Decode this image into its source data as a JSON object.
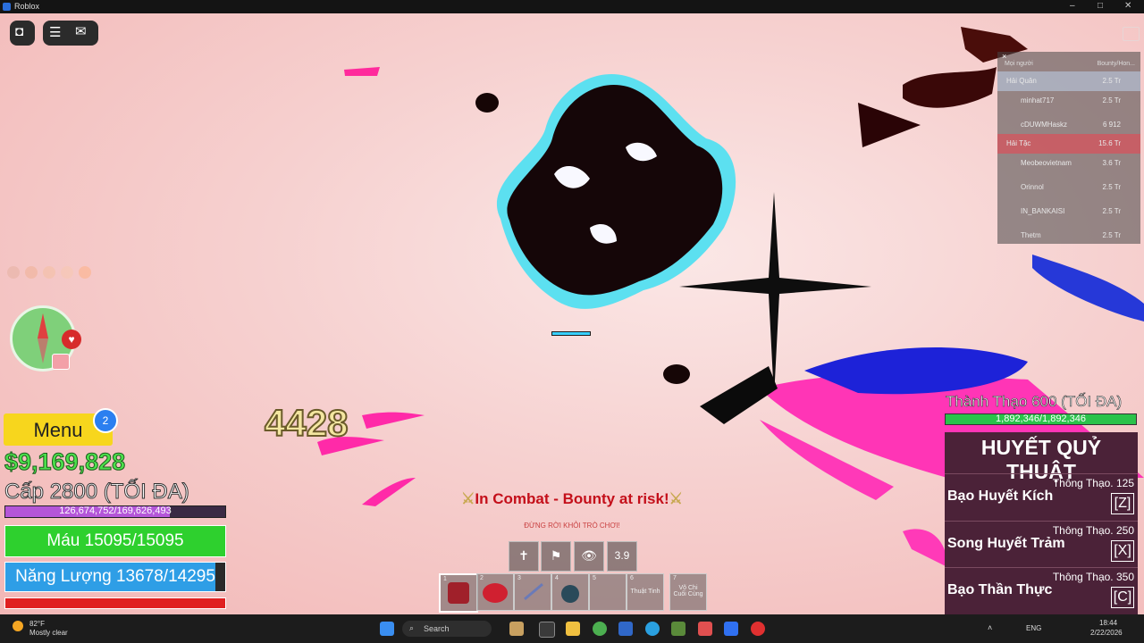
{
  "window": {
    "title": "Roblox",
    "controls": [
      "–",
      "□",
      "✕"
    ]
  },
  "top_buttons": {
    "roblox_icon": "roblox-logo-icon",
    "menu_icon": "hamburger-icon",
    "chat_icon": "chat-icon"
  },
  "playerlist": {
    "header_left": "Mọi người",
    "header_right": "Bounty/Hon...",
    "rows": [
      {
        "name": "Hải Quân",
        "bounty": "2.5 Tr",
        "highlight": "blue"
      },
      {
        "name": "minhat717",
        "bounty": "2.5 Tr",
        "highlight": ""
      },
      {
        "name": "cDUWMHaskz",
        "bounty": "6 912",
        "highlight": ""
      },
      {
        "name": "Hải Tặc",
        "bounty": "15.6 Tr",
        "highlight": "red"
      },
      {
        "name": "Meobeovietnam",
        "bounty": "3.6 Tr",
        "highlight": ""
      },
      {
        "name": "Orinnol",
        "bounty": "2.5 Tr",
        "highlight": ""
      },
      {
        "name": "IN_BANKAISI",
        "bounty": "2.5 Tr",
        "highlight": ""
      },
      {
        "name": "Thetm",
        "bounty": "2.5 Tr",
        "highlight": ""
      }
    ]
  },
  "left_hud": {
    "menu_label": "Menu",
    "menu_badge": "2",
    "money": "$9,169,828",
    "level": "Cấp 2800 (TỐI ĐA)",
    "xp_text": "126,674,752/169,626,493",
    "xp_fraction": 0.747,
    "health_text": "Máu 15095/15095",
    "health_fraction": 1.0,
    "energy_text": "Năng Lượng 13678/14295",
    "energy_fraction": 0.957
  },
  "combat": {
    "damage_number": "4428",
    "sword_left": "⚔",
    "message": "In Combat - Bounty at risk!",
    "sword_right": "⚔",
    "subwarning": "ĐỪNG RỜI KHỎI TRÒ CHƠI!"
  },
  "abilities": [
    "✝",
    "⚑",
    "👁",
    "3.9"
  ],
  "hotbar": [
    {
      "num": "1",
      "label": ""
    },
    {
      "num": "2",
      "label": ""
    },
    {
      "num": "3",
      "label": ""
    },
    {
      "num": "4",
      "label": ""
    },
    {
      "num": "5",
      "label": ""
    },
    {
      "num": "6",
      "label": "Thuật Tinh"
    },
    {
      "num": "7",
      "label": "Võ Chi Cuối Cùng"
    }
  ],
  "mastery": {
    "title": "Thành Thạo 600 (TỐI ĐA)",
    "bar_text": "1,892,346/1,892,346",
    "fraction": 1.0,
    "style_name": "HUYẾT QUỶ THUẬT",
    "skills": [
      {
        "mastery": "Thông Thạo. 125",
        "name": "Bạo Huyết Kích",
        "key": "[Z]"
      },
      {
        "mastery": "Thông Thạo. 250",
        "name": "Song Huyết Trảm",
        "key": "[X]"
      },
      {
        "mastery": "Thông Thạo. 350",
        "name": "Bạo Thần Thực",
        "key": "[C]"
      }
    ]
  },
  "taskbar": {
    "weather_temp": "82°F",
    "weather_desc": "Mostly clear",
    "search_placeholder": "Search",
    "lang": "ENG",
    "time": "18:44",
    "date": "2/22/2026"
  },
  "colors": {
    "sky": "#f4c6c4",
    "money": "#4ce04c",
    "health": "#2ed02e",
    "energy": "#2e9ee6",
    "combat": "#c40f1a",
    "skills_panel": "#4b2238"
  }
}
